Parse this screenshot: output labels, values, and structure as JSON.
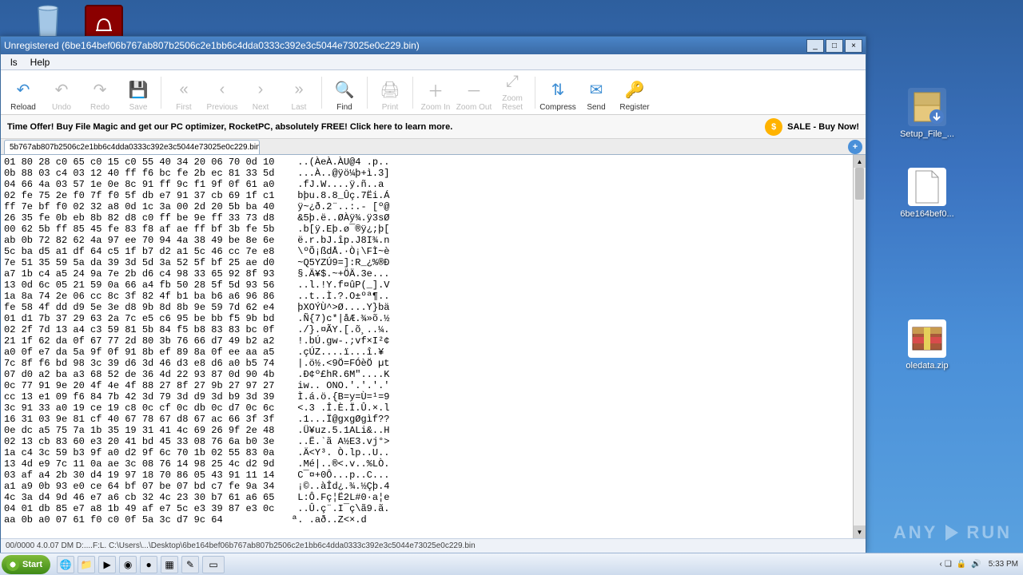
{
  "desktop": {
    "recycle": "",
    "pdf": "",
    "setup": "Setup_File_...",
    "bin": "6be164bef0...",
    "oled": "oledata.zip"
  },
  "window": {
    "title": "Unregistered (6be164bef06b767ab807b2506c2e1bb6c4dda0333c392e3c5044e73025e0c229.bin)"
  },
  "menu": {
    "ls": "ls",
    "help": "Help"
  },
  "toolbar": {
    "reload": "Reload",
    "undo": "Undo",
    "redo": "Redo",
    "save": "Save",
    "first": "First",
    "previous": "Previous",
    "next": "Next",
    "last": "Last",
    "find": "Find",
    "print": "Print",
    "zoomin": "Zoom In",
    "zoomout": "Zoom Out",
    "zoomreset": "Zoom Reset",
    "compress": "Compress",
    "send": "Send",
    "register": "Register"
  },
  "promo": {
    "msg": "Time Offer! Buy File Magic and get our PC optimizer, RocketPC, absolutely FREE! Click here to learn more.",
    "sale": "SALE - Buy Now!"
  },
  "tab": {
    "label": "5b767ab807b2506c2e1bb6c4dda0333c392e3c5044e73025e0c229.bin",
    "close": "×"
  },
  "hex_lines": [
    "01 80 28 c0 65 c0 15 c0 55 40 34 20 06 70 0d 10    ..(ÀeÀ.ÀU@4 .p..",
    "0b 88 03 c4 03 12 40 ff f6 bc fe 2b ec 81 33 5d    ...À..@ÿö¼þ+ì.3]",
    "04 66 4a 03 57 1e 0e 8c 91 ff 9c f1 9f 0f 61 a0    .fJ.W....ÿ.ñ..a ",
    "02 fe 75 2e f0 7f f0 5f db e7 91 37 cb 69 1f c1    bþu.8.8_Ûç.7Ëi.Á",
    "ff 7e bf f0 02 32 a8 0d 1c 3a 00 2d 20 5b ba 40    ÿ~¿ð.2¨..:.- [º@",
    "26 35 fe 0b eb 8b 82 d8 c0 ff be 9e ff 33 73 d8    &5þ.ë..ØÀÿ¾.ÿ3sØ",
    "00 62 5b ff 85 45 fe 83 f8 af ae ff bf 3b fe 5b    .b[ÿ.Eþ.ø¯®ÿ¿;þ[",
    "ab 0b 72 82 62 4a 97 ee 70 94 4a 38 49 be 8e 6e    ë.r.bJ.îp.J8I¾.n",
    "5c ba d5 a1 df 64 c5 1f b7 d2 a1 5c 46 cc 7e e8    \\ºÕ¡ßdÅ.·Ò¡\\FÌ~è",
    "7e 51 35 59 5a da 39 3d 5d 3a 52 5f bf 25 ae d0    ~Q5YZÚ9=]:R_¿%®Ð",
    "a7 1b c4 a5 24 9a 7e 2b d6 c4 98 33 65 92 8f 93    §.Ä¥$.~+ÖÄ.3e...",
    "13 0d 6c 05 21 59 0a 66 a4 fb 50 28 5f 5d 93 56    ..l.!Y.f¤ûP(_].V",
    "1a 8a 74 2e 06 cc 8c 3f 82 4f b1 ba b6 a6 96 86    ..t..Ì.?.O±ºª¶..",
    "fe 58 4f dd d9 5e 3e d8 9b 8d 8b 9e 59 7d 62 e4    þXOÝÙ^>Ø....Y}bä",
    "01 d1 7b 37 29 63 2a 7c e5 c6 95 be bb f5 9b bd    .Ñ{7)c*|åÆ.¾»õ.½",
    "02 2f 7d 13 a4 c3 59 81 5b 84 f5 b8 83 83 bc 0f    ./}.¤ÃY.[.õ¸..¼.",
    "21 1f 62 da 0f 67 77 2d 80 3b 76 66 d7 49 b2 a2    !.bÚ.gw-.;vf×I²¢",
    "a0 0f e7 da 5a 9f 0f 91 8b ef 89 8a 0f ee aa a5    .çÚZ....ï...î.¥",
    "7c 8f f6 bd 98 3c 39 d6 3d 46 d3 e8 d6 a0 b5 74    |.ö½.<9Ö=FÓèÖ µt",
    "07 d0 a2 ba a3 68 52 de 36 4d 22 93 87 0d 90 4b    .Ð¢º£hR.6M\"....K",
    "0c 77 91 9e 20 4f 4e 4f 88 27 8f 27 9b 27 97 27    iw.. ONO.'.'.'.'",
    "cc 13 e1 09 f6 84 7b 42 3d 79 3d d9 3d b9 3d 39    Ì.á.ö.{B=y=Ù=¹=9",
    "3c 91 33 a0 19 ce 19 c8 0c cf 0c db 0c d7 0c 6c    <.3 .Î.È.Ï.Û.×.l",
    "16 31 03 9e 81 cf 40 67 78 67 d8 67 ac 66 3f 3f    .1...Ï@gxgØgìf??",
    "0e dc a5 75 7a 1b 35 19 31 41 4c 69 26 9f 2e 48    .Ü¥uz.5.1ALi&..H",
    "02 13 cb 83 60 e3 20 41 bd 45 33 08 76 6a b0 3e    ..Ë.`ã A½E3.vj°>",
    "1a c4 3c 59 b3 9f a0 d2 9f 6c 70 1b 02 55 83 0a    .Ä<Y³. Ò.lp..U..",
    "13 4d e9 7c 11 0a ae 3c 08 76 14 98 25 4c d2 9d    .Mé|..®<.v..%LÒ.",
    "03 af a4 2b 30 d4 19 97 18 70 86 05 43 91 11 14    C¯¤+0Ô...p..C...",
    "a1 a9 0b 93 e0 ce 64 bf 07 be 07 bd c7 fe 9a 34    ¡©..àÎd¿.¾.½Çþ.4",
    "4c 3a d4 9d 46 e7 a6 cb 32 4c 23 30 b7 61 a6 65    L:Ô.Fç¦Ë2L#0·a¦e",
    "04 01 db 85 e7 a8 1b 49 af e7 5c e3 39 87 e3 0c    ..Û.ç¨.I¯ç\\ã9.ã.",
    "aa 0b a0 07 61 f0 c0 0f 5a 3c d7 9c 64            ª. .að..Z<×.d   "
  ],
  "status": "00/0000 4.0.07 DM     D:....F:L.    C:\\Users\\...\\Desktop\\6be164bef06b767ab807b2506c2e1bb6c4dda0333c392e3c5044e73025e0c229.bin",
  "taskbar": {
    "start": "Start",
    "clock": "5:33 PM"
  },
  "watermark": {
    "left": "ANY",
    "right": "RUN"
  }
}
